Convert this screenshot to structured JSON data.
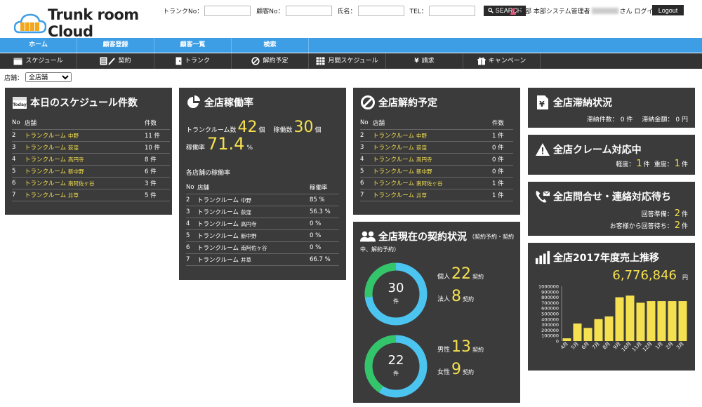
{
  "header": {
    "logo_text": "Trunk room Cloud",
    "trunk_no_label": "トランクNo：",
    "customer_no_label": "顧客No：",
    "name_label": "氏名：",
    "tel_label": "TEL：",
    "search_button": "SEARCH",
    "user_prefix": "本部 本部システム管理者",
    "user_suffix": "さん ログイン中",
    "logout_button": "Logout"
  },
  "nav_primary": [
    "ホーム",
    "顧客登録",
    "顧客一覧",
    "検索"
  ],
  "nav_secondary": [
    {
      "label": "スケジュール",
      "icon": "calendar-icon"
    },
    {
      "label": "契約",
      "icon": "contract-icon"
    },
    {
      "label": "トランク",
      "icon": "door-icon"
    },
    {
      "label": "解約予定",
      "icon": "cancel-icon"
    },
    {
      "label": "月間スケジュール",
      "icon": "grid-calendar-icon"
    },
    {
      "label": "請求",
      "icon": "yen-icon"
    },
    {
      "label": "キャンペーン",
      "icon": "gift-icon"
    }
  ],
  "store_filter": {
    "label": "店舗：",
    "value": "全店舗"
  },
  "schedule": {
    "title": "本日のスケジュール件数",
    "col_no": "No",
    "col_store": "店舗",
    "col_count": "件数",
    "rows": [
      {
        "no": "2",
        "name": "トランクルーム",
        "area": "中野",
        "val": "11 件"
      },
      {
        "no": "3",
        "name": "トランクルーム",
        "area": "荻窪",
        "val": "10 件"
      },
      {
        "no": "4",
        "name": "トランクルーム",
        "area": "高円寺",
        "val": "8 件"
      },
      {
        "no": "5",
        "name": "トランクルーム",
        "area": "新中野",
        "val": "6 件"
      },
      {
        "no": "6",
        "name": "トランクルーム",
        "area": "南阿佐ヶ谷",
        "val": "3 件"
      },
      {
        "no": "7",
        "name": "トランクルーム",
        "area": "井草",
        "val": "5 件"
      }
    ]
  },
  "occupancy": {
    "title": "全店稼働率",
    "rooms_label": "トランクルーム数",
    "rooms_value": "42",
    "rooms_unit": "個",
    "active_label": "稼働数",
    "active_value": "30",
    "active_unit": "個",
    "rate_label": "稼働率",
    "rate_value": "71.4",
    "rate_unit": "%",
    "sub_title": "各店舗の稼働率",
    "col_no": "No",
    "col_store": "店舗",
    "col_rate": "稼働率",
    "rows": [
      {
        "no": "2",
        "name": "トランクルーム",
        "area": "中野",
        "val": "85 %"
      },
      {
        "no": "3",
        "name": "トランクルーム",
        "area": "荻窪",
        "val": "56.3 %"
      },
      {
        "no": "4",
        "name": "トランクルーム",
        "area": "高円寺",
        "val": "0 %"
      },
      {
        "no": "5",
        "name": "トランクルーム",
        "area": "新中野",
        "val": "0 %"
      },
      {
        "no": "6",
        "name": "トランクルーム",
        "area": "南阿佐ヶ谷",
        "val": "0 %"
      },
      {
        "no": "7",
        "name": "トランクルーム",
        "area": "井草",
        "val": "66.7 %"
      }
    ]
  },
  "cancel": {
    "title": "全店解約予定",
    "col_no": "No",
    "col_store": "店舗",
    "col_count": "件数",
    "rows": [
      {
        "no": "2",
        "name": "トランクルーム",
        "area": "中野",
        "val": "1 件"
      },
      {
        "no": "3",
        "name": "トランクルーム",
        "area": "荻窪",
        "val": "0 件"
      },
      {
        "no": "4",
        "name": "トランクルーム",
        "area": "高円寺",
        "val": "0 件"
      },
      {
        "no": "5",
        "name": "トランクルーム",
        "area": "新中野",
        "val": "0 件"
      },
      {
        "no": "6",
        "name": "トランクルーム",
        "area": "南阿佐ヶ谷",
        "val": "1 件"
      },
      {
        "no": "7",
        "name": "トランクルーム",
        "area": "井草",
        "val": "1 件"
      }
    ]
  },
  "contracts": {
    "title": "全店現在の契約状況",
    "title_note_1": "（契約予約・契約",
    "title_note_2": "中、解約予約）",
    "donut1": {
      "total": "30",
      "unit": "件",
      "individual_label": "個人",
      "individual": "22",
      "corporate_label": "法人",
      "corporate": "8",
      "suffix": "契約",
      "share_individual": 0.733
    },
    "donut2": {
      "total": "22",
      "unit": "件",
      "male_label": "男性",
      "male": "13",
      "female_label": "女性",
      "female": "9",
      "suffix": "契約",
      "share_male": 0.591
    }
  },
  "overdue": {
    "title": "全店滞納状況",
    "count_label": "滞納件数：",
    "count": "0 件",
    "amount_label": "滞納金額：",
    "amount": "0 円"
  },
  "claims": {
    "title": "全店クレーム対応中",
    "light_label": "軽度：",
    "light": "1",
    "light_unit": "件",
    "heavy_label": "重度：",
    "heavy": "1",
    "heavy_unit": "件"
  },
  "inquiries": {
    "title": "全店問合せ・連絡対応待ち",
    "reply_label": "回答準備：",
    "reply": "2",
    "reply_unit": "件",
    "wait_label": "お客様から回答待ち：",
    "wait": "2",
    "wait_unit": "件"
  },
  "sales": {
    "title": "全店2017年度売上推移",
    "total": "6,776,846",
    "unit": "円"
  },
  "colors": {
    "accent_yellow": "#f5e04f",
    "donut_blue": "#4cc4f0",
    "donut_green": "#34c46a",
    "nav_blue": "#3d9ee6"
  },
  "chart_data": {
    "type": "bar",
    "categories": [
      "4月",
      "5月",
      "6月",
      "7月",
      "8月",
      "9月",
      "10月",
      "11月",
      "12月",
      "1月",
      "2月",
      "3月"
    ],
    "values": [
      50000,
      320000,
      240000,
      400000,
      450000,
      800000,
      830000,
      700000,
      730000,
      730000,
      730000,
      730000
    ],
    "yticks": [
      "0",
      "100000",
      "200000",
      "300000",
      "400000",
      "500000",
      "600000",
      "700000",
      "800000",
      "900000",
      "1000000"
    ],
    "ylim": [
      0,
      1000000
    ],
    "grid": false
  }
}
